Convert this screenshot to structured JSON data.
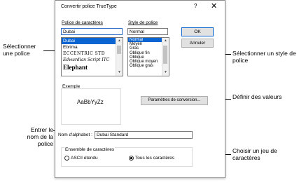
{
  "dialog": {
    "title": "Convertir police TrueType",
    "help": "?",
    "close": "✕",
    "font_label": "Police de caractères",
    "font_input": "Dubai",
    "fonts": [
      "Dubai",
      "Ebrima",
      "ECCENTRIC STD",
      "Edwardian Script ITC",
      "Elephant"
    ],
    "selected_font_index": 0,
    "style_label": "Style de police",
    "style_input": "Normal",
    "styles": [
      "Normal",
      "Moyen",
      "Gras",
      "Oblique fin",
      "Oblique",
      "Oblique moyen",
      "Oblique gras"
    ],
    "selected_style_index": 0,
    "ok_button": "OK",
    "cancel_button": "Annuler",
    "sample_label": "Exemple",
    "sample_text": "AaBbYyZz",
    "conversion_button": "Paramètres de conversion...",
    "alphabet_label": "Nom d'alphabet :",
    "alphabet_value": "Dubai Standard",
    "charset_label": "Ensemble de caractères",
    "radio_ascii": "ASCII étendu",
    "radio_all": "Tous les caractères",
    "radio_selected": "all"
  },
  "callouts": {
    "select_font": "Sélectionner une police",
    "select_style": "Sélectionner un style de police",
    "define_values": "Définir des valeurs",
    "enter_name": "Entrer le nom de la police",
    "choose_charset": "Choisir un jeu de caractères"
  }
}
